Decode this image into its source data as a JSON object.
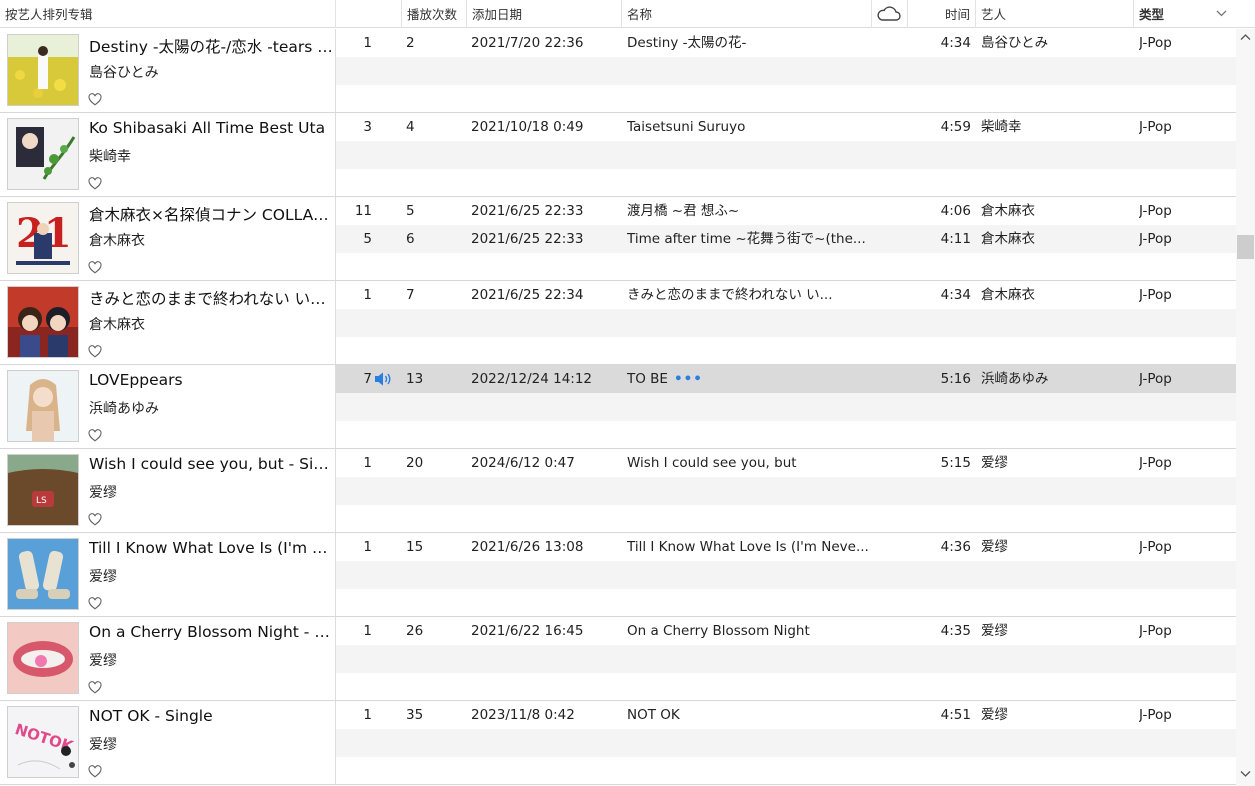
{
  "header": {
    "columns": {
      "album": "按艺人排列专辑",
      "track": "",
      "plays": "播放次数",
      "date": "添加日期",
      "name": "名称",
      "time": "时间",
      "artist": "艺人",
      "genre": "类型"
    },
    "cloud_icon": "cloud-icon",
    "sort_icon": "chevron-down-icon"
  },
  "albums": [
    {
      "title": "Destiny -太陽の花-/恋水 -tears of love-",
      "artist": "島谷ひとみ",
      "tracks": [
        {
          "track": "1",
          "plays": "2",
          "date": "2021/7/20 22:36",
          "name": "Destiny -太陽の花-",
          "time": "4:34",
          "artist": "島谷ひとみ",
          "genre": "J-Pop"
        }
      ]
    },
    {
      "title": "Ko Shibasaki All Time Best Uta",
      "artist": "柴崎幸",
      "tracks": [
        {
          "track": "3",
          "plays": "4",
          "date": "2021/10/18 0:49",
          "name": "Taisetsuni Suruyo",
          "time": "4:59",
          "artist": "柴崎幸",
          "genre": "J-Pop"
        }
      ]
    },
    {
      "title": "倉木麻衣×名探偵コナン COLLABORATION",
      "artist": "倉木麻衣",
      "tracks": [
        {
          "track": "11",
          "plays": "5",
          "date": "2021/6/25 22:33",
          "name": "渡月橋 ~君 想ふ~",
          "time": "4:06",
          "artist": "倉木麻衣",
          "genre": "J-Pop"
        },
        {
          "track": "5",
          "plays": "6",
          "date": "2021/6/25 22:33",
          "name": "Time after time ~花舞う街で~(the...",
          "time": "4:11",
          "artist": "倉木麻衣",
          "genre": "J-Pop"
        }
      ]
    },
    {
      "title": "きみと恋のままで終われない いつも夢のままじゃいられない",
      "artist": "倉木麻衣",
      "tracks": [
        {
          "track": "1",
          "plays": "7",
          "date": "2021/6/25 22:34",
          "name": "きみと恋のままで終われない い...",
          "time": "4:34",
          "artist": "倉木麻衣",
          "genre": "J-Pop"
        }
      ]
    },
    {
      "title": "LOVEppears",
      "artist": "浜崎あゆみ",
      "tracks": [
        {
          "track": "7",
          "plays": "13",
          "date": "2022/12/24 14:12",
          "name": "TO BE",
          "time": "5:16",
          "artist": "浜崎あゆみ",
          "genre": "J-Pop",
          "playing": true,
          "more_icon": "•••"
        }
      ]
    },
    {
      "title": "Wish I could see you, but - Single",
      "artist": "爱缪",
      "tracks": [
        {
          "track": "1",
          "plays": "20",
          "date": "2024/6/12 0:47",
          "name": "Wish I could see you, but",
          "time": "5:15",
          "artist": "爱缪",
          "genre": "J-Pop"
        }
      ]
    },
    {
      "title": "Till I Know What Love Is (I'm Never Alone) - Single",
      "artist": "爱缪",
      "tracks": [
        {
          "track": "1",
          "plays": "15",
          "date": "2021/6/26 13:08",
          "name": "Till I Know What Love Is (I'm Neve...",
          "time": "4:36",
          "artist": "爱缪",
          "genre": "J-Pop"
        }
      ]
    },
    {
      "title": "On a Cherry Blossom Night - Single",
      "artist": "爱缪",
      "tracks": [
        {
          "track": "1",
          "plays": "26",
          "date": "2021/6/22 16:45",
          "name": "On a Cherry Blossom Night",
          "time": "4:35",
          "artist": "爱缪",
          "genre": "J-Pop"
        }
      ]
    },
    {
      "title": "NOT OK - Single",
      "artist": "爱缪",
      "tracks": [
        {
          "track": "1",
          "plays": "35",
          "date": "2023/11/8 0:42",
          "name": "NOT OK",
          "time": "4:51",
          "artist": "爱缪",
          "genre": "J-Pop"
        }
      ]
    }
  ]
}
